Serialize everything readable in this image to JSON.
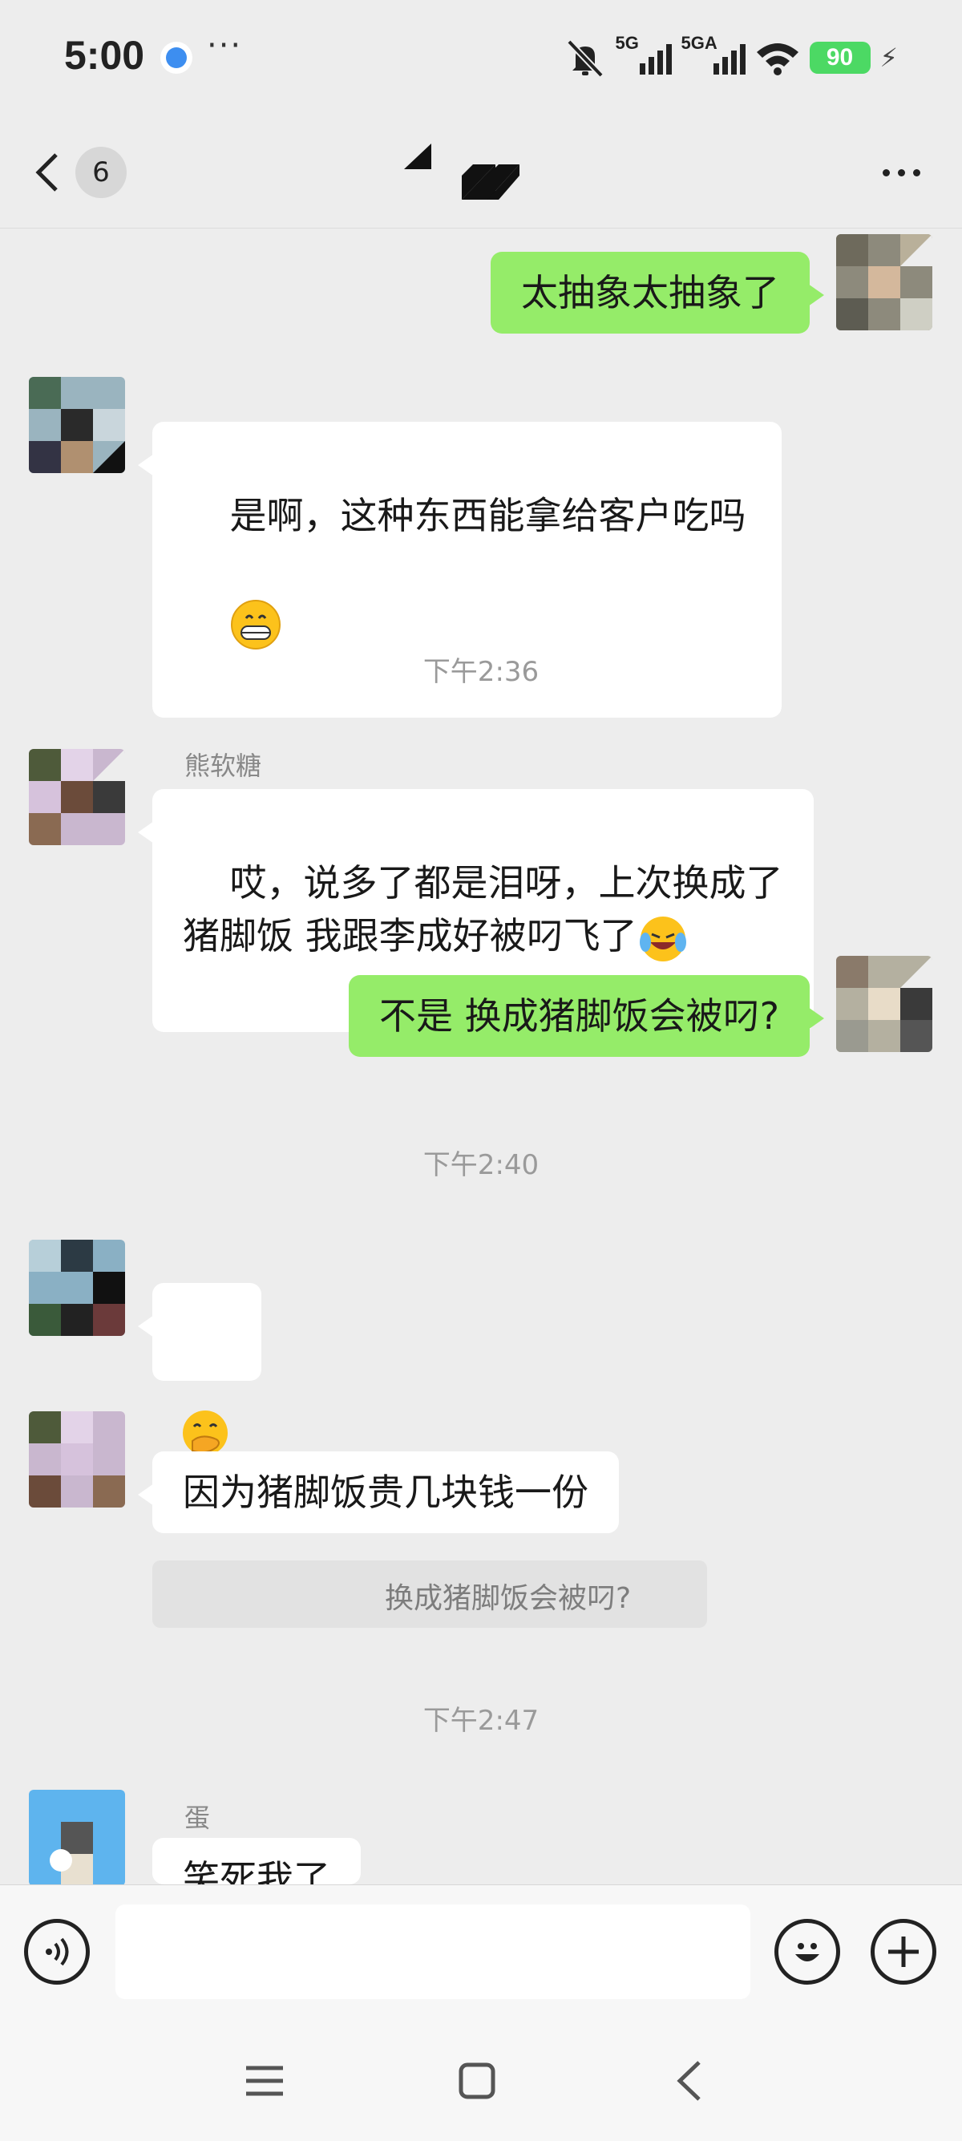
{
  "status_bar": {
    "time": "5:00",
    "dots": "···",
    "signal1_label": "5G",
    "signal2_label": "5GA",
    "battery": "90"
  },
  "nav": {
    "unread_count": "6"
  },
  "messages": {
    "m1_text": "太抽象太抽象了",
    "m2_text": "是啊，这种东西能拿给客户吃吗",
    "ts1": "下午2:36",
    "m3_name": "熊软糖",
    "m3_text": "哎，说多了都是泪呀，上次换成了\n猪脚饭 我跟李成好被叼飞了",
    "m4_text": "不是 换成猪脚饭会被叼?",
    "ts2": "下午2:40",
    "m6_text": "因为猪脚饭贵几块钱一份",
    "m6_quote": "换成猪脚饭会被叼?",
    "ts3": "下午2:47",
    "m7_name": "蛋",
    "m7_text": "笑死我了"
  },
  "colors": {
    "bubble_out": "#95ec69",
    "bubble_in": "#ffffff",
    "background": "#ededed"
  }
}
